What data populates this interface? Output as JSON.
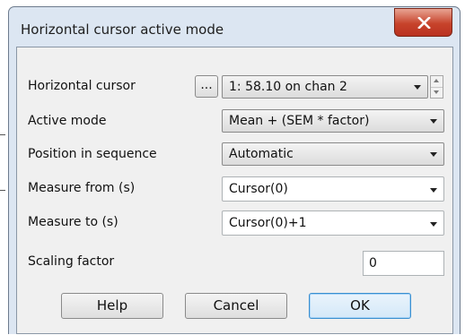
{
  "window": {
    "title": "Horizontal cursor active mode",
    "close_glyph": "X"
  },
  "form": {
    "horizontal_cursor": {
      "label": "Horizontal cursor",
      "browse_label": "...",
      "value": "1: 58.10 on chan 2"
    },
    "active_mode": {
      "label": "Active mode",
      "value": "Mean + (SEM * factor)"
    },
    "position_in_sequence": {
      "label": "Position in sequence",
      "value": "Automatic"
    },
    "measure_from": {
      "label": "Measure from (s)",
      "value": "Cursor(0)"
    },
    "measure_to": {
      "label": "Measure to (s)",
      "value": "Cursor(0)+1"
    },
    "scaling_factor": {
      "label": "Scaling factor",
      "value": "0"
    }
  },
  "buttons": {
    "help": "Help",
    "cancel": "Cancel",
    "ok": "OK"
  },
  "colors": {
    "frame": "#dce6f2",
    "client": "#f0f0f0",
    "close_button": "#c7432b",
    "default_button_border": "#3a8fd0"
  },
  "icons": {
    "close": "close-icon",
    "combo_arrow": "chevron-down-icon",
    "spin_up": "chevron-up-icon",
    "spin_down": "chevron-down-icon"
  }
}
